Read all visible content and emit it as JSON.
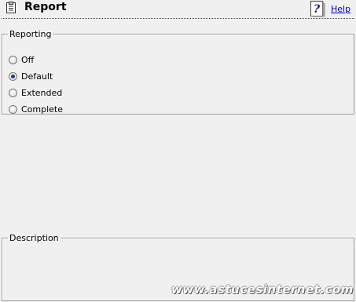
{
  "header": {
    "title": "Report",
    "help_label": "Help"
  },
  "reporting": {
    "legend": "Reporting",
    "options": [
      {
        "label": "Off",
        "checked": false
      },
      {
        "label": "Default",
        "checked": true
      },
      {
        "label": "Extended",
        "checked": false
      },
      {
        "label": "Complete",
        "checked": false
      }
    ]
  },
  "description": {
    "legend": "Description"
  },
  "watermark": "www.astucesinternet.com"
}
